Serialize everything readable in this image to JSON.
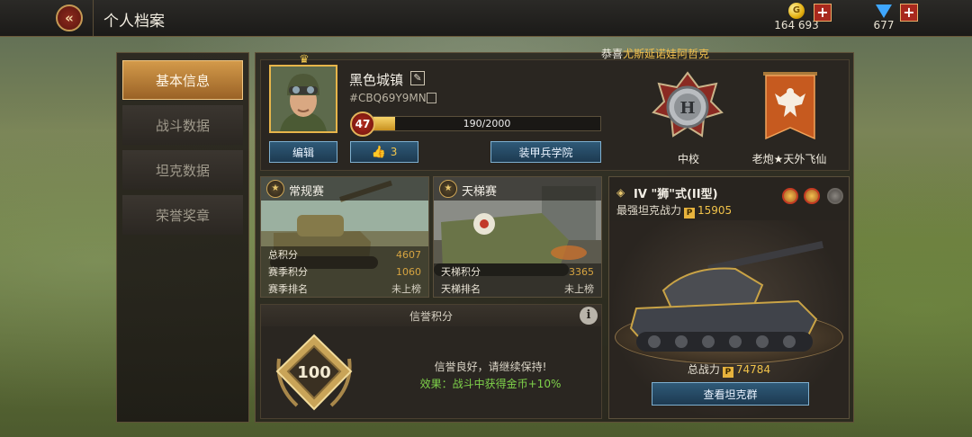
{
  "header": {
    "title": "个人档案",
    "gold": "164 693",
    "gems": "677",
    "icons": {
      "back": "double-chevron-left-icon",
      "gold": "coin-icon",
      "gems": "diamond-icon",
      "add": "plus-icon"
    }
  },
  "sidebar": {
    "items": [
      {
        "label": "基本信息",
        "active": true
      },
      {
        "label": "战斗数据",
        "active": false
      },
      {
        "label": "坦克数据",
        "active": false
      },
      {
        "label": "荣誉奖章",
        "active": false
      }
    ]
  },
  "congrats": {
    "prefix": "恭喜",
    "name": "尤斯延诺娃阿哲克"
  },
  "profile": {
    "name": "黑色城镇",
    "id": "#CBQ69Y9MN",
    "level": "47",
    "xp_text": "190/2000",
    "xp_fraction": 0.095,
    "edit_label": "编辑",
    "likes": "3",
    "academy_label": "装甲兵学院",
    "rank": "中校",
    "title": "老炮★天外飞仙"
  },
  "modes": [
    {
      "title": "常规赛",
      "stats": [
        {
          "label": "总积分",
          "value": "4607"
        },
        {
          "label": "赛季积分",
          "value": "1060"
        },
        {
          "label": "赛季排名",
          "value": "未上榜"
        }
      ]
    },
    {
      "title": "天梯赛",
      "stats": [
        {
          "label": "天梯积分",
          "value": "3365"
        },
        {
          "label": "天梯排名",
          "value": "未上榜"
        }
      ]
    }
  ],
  "honor": {
    "title": "信誉积分",
    "score": "100",
    "message": "信誉良好，请继续保持!",
    "effect": "效果：战斗中获得金币+10%"
  },
  "tank": {
    "tier": "IV",
    "name": "\"狮\"式(II型)",
    "strongest_label": "最强坦克战力",
    "strongest_power": "15905",
    "total_label": "总战力",
    "total_power": "74784",
    "view_label": "查看坦克群"
  },
  "colors": {
    "accent": "#d39a4a",
    "gold_text": "#f0c24a",
    "green_text": "#7fd24a",
    "button_blue": "#2f5a78"
  }
}
